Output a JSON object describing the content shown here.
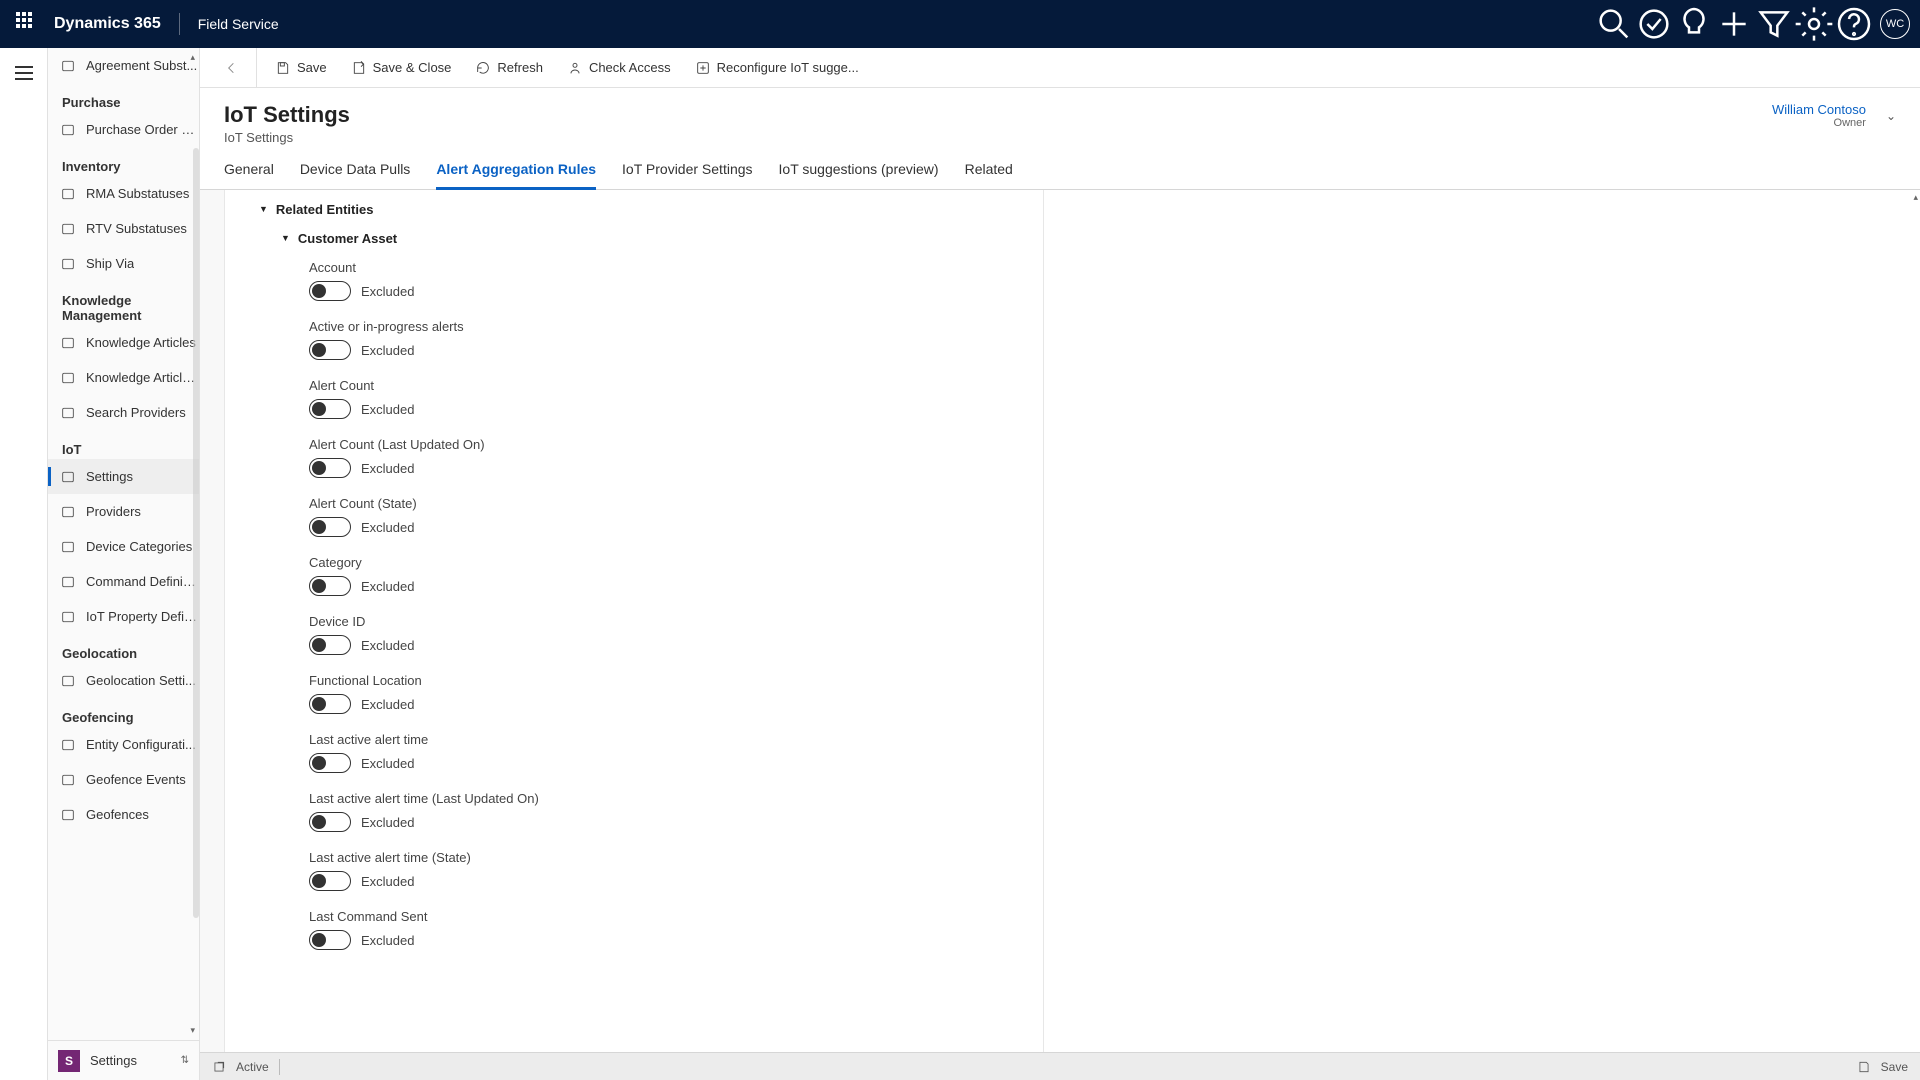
{
  "topbar": {
    "brand": "Dynamics 365",
    "area": "Field Service",
    "avatar_initials": "WC"
  },
  "sidebar": {
    "top_item": "Agreement Subst...",
    "groups": [
      {
        "title": "Purchase",
        "items": [
          "Purchase Order S..."
        ]
      },
      {
        "title": "Inventory",
        "items": [
          "RMA Substatuses",
          "RTV Substatuses",
          "Ship Via"
        ]
      },
      {
        "title": "Knowledge Management",
        "items": [
          "Knowledge Articles",
          "Knowledge Article...",
          "Search Providers"
        ]
      },
      {
        "title": "IoT",
        "items": [
          "Settings",
          "Providers",
          "Device Categories",
          "Command Definiti...",
          "IoT Property Defin..."
        ]
      },
      {
        "title": "Geolocation",
        "items": [
          "Geolocation Setti..."
        ]
      },
      {
        "title": "Geofencing",
        "items": [
          "Entity Configurati...",
          "Geofence Events",
          "Geofences"
        ]
      }
    ],
    "active": "Settings",
    "area_switch": "Settings"
  },
  "commandbar": {
    "save": "Save",
    "save_close": "Save & Close",
    "refresh": "Refresh",
    "check_access": "Check Access",
    "reconfigure": "Reconfigure IoT sugge..."
  },
  "header": {
    "title": "IoT Settings",
    "subtitle": "IoT Settings",
    "owner_name": "William Contoso",
    "owner_label": "Owner"
  },
  "tabs": [
    "General",
    "Device Data Pulls",
    "Alert Aggregation Rules",
    "IoT Provider Settings",
    "IoT suggestions (preview)",
    "Related"
  ],
  "active_tab": "Alert Aggregation Rules",
  "form": {
    "section": "Related Entities",
    "subsection": "Customer Asset",
    "toggle_value": "Excluded",
    "fields": [
      "Account",
      "Active or in-progress alerts",
      "Alert Count",
      "Alert Count (Last Updated On)",
      "Alert Count (State)",
      "Category",
      "Device ID",
      "Functional Location",
      "Last active alert time",
      "Last active alert time (Last Updated On)",
      "Last active alert time (State)",
      "Last Command Sent"
    ]
  },
  "statusbar": {
    "status": "Active",
    "save": "Save"
  }
}
